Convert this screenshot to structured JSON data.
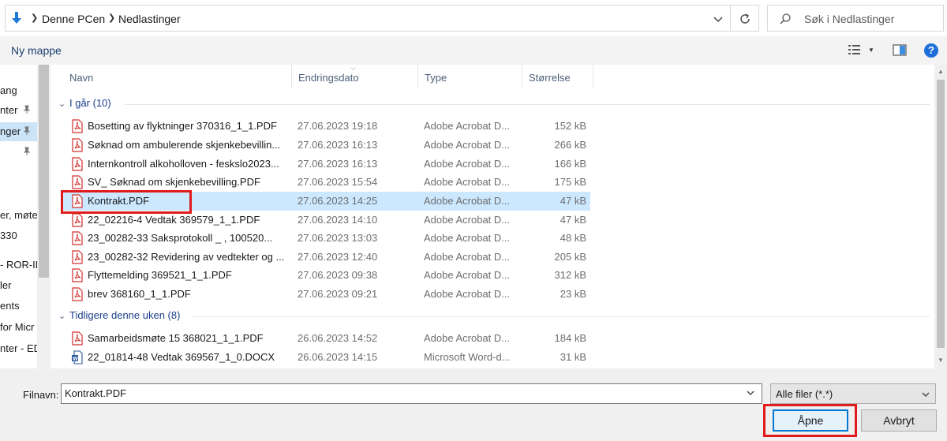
{
  "address": {
    "crumbs": [
      "Denne PCen",
      "Nedlastinger"
    ],
    "search_placeholder": "Søk i Nedlastinger"
  },
  "toolbar": {
    "new_folder_label": "Ny mappe",
    "help_label": "?"
  },
  "sidebar": {
    "items": [
      {
        "label": "ang",
        "pinned": false
      },
      {
        "label": "nter",
        "pinned": true
      },
      {
        "label": "nger",
        "pinned": true,
        "selected": true
      },
      {
        "label": "",
        "pinned": true
      },
      {
        "label": "er, møte",
        "pinned": false
      },
      {
        "label": "330",
        "pinned": false
      },
      {
        "label": "- ROR-IK",
        "pinned": false
      },
      {
        "label": "ler",
        "pinned": false
      },
      {
        "label": "ents",
        "pinned": false
      },
      {
        "label": "for Micr",
        "pinned": false
      },
      {
        "label": "nter - ED",
        "pinned": false
      }
    ]
  },
  "columns": [
    "Navn",
    "Endringsdato",
    "Type",
    "Størrelse"
  ],
  "groups": [
    {
      "label": "I går (10)",
      "rows": [
        {
          "name": "Bosetting av flyktninger 370316_1_1.PDF",
          "date": "27.06.2023 19:18",
          "type": "Adobe Acrobat D...",
          "size": "152 kB",
          "icon": "pdf"
        },
        {
          "name": "Søknad om ambulerende skjenkebevillin...",
          "date": "27.06.2023 16:13",
          "type": "Adobe Acrobat D...",
          "size": "266 kB",
          "icon": "pdf"
        },
        {
          "name": "Internkontroll alkoholloven - feskslo2023...",
          "date": "27.06.2023 16:13",
          "type": "Adobe Acrobat D...",
          "size": "166 kB",
          "icon": "pdf"
        },
        {
          "name": "SV_ Søknad om skjenkebevilling.PDF",
          "date": "27.06.2023 15:54",
          "type": "Adobe Acrobat D...",
          "size": "175 kB",
          "icon": "pdf"
        },
        {
          "name": "Kontrakt.PDF",
          "date": "27.06.2023 14:25",
          "type": "Adobe Acrobat D...",
          "size": "47 kB",
          "icon": "pdf",
          "selected": true
        },
        {
          "name": "22_02216-4 Vedtak 369579_1_1.PDF",
          "date": "27.06.2023 14:10",
          "type": "Adobe Acrobat D...",
          "size": "47 kB",
          "icon": "pdf"
        },
        {
          "name": "23_00282-33 Saksprotokoll _    , 100520...",
          "date": "27.06.2023 13:03",
          "type": "Adobe Acrobat D...",
          "size": "48 kB",
          "icon": "pdf"
        },
        {
          "name": "23_00282-32 Revidering av vedtekter og ...",
          "date": "27.06.2023 12:40",
          "type": "Adobe Acrobat D...",
          "size": "205 kB",
          "icon": "pdf"
        },
        {
          "name": "Flyttemelding 369521_1_1.PDF",
          "date": "27.06.2023 09:38",
          "type": "Adobe Acrobat D...",
          "size": "312 kB",
          "icon": "pdf"
        },
        {
          "name": "brev 368160_1_1.PDF",
          "date": "27.06.2023 09:21",
          "type": "Adobe Acrobat D...",
          "size": "23 kB",
          "icon": "pdf"
        }
      ]
    },
    {
      "label": "Tidligere denne uken (8)",
      "rows": [
        {
          "name": "Samarbeidsmøte 15 368021_1_1.PDF",
          "date": "26.06.2023 14:52",
          "type": "Adobe Acrobat D...",
          "size": "184 kB",
          "icon": "pdf"
        },
        {
          "name": "22_01814-48 Vedtak 369567_1_0.DOCX",
          "date": "26.06.2023 14:15",
          "type": "Microsoft Word-d...",
          "size": "31 kB",
          "icon": "word"
        }
      ]
    }
  ],
  "bottom": {
    "filename_label": "Filnavn:",
    "filename_value": "Kontrakt.PDF",
    "filter_value": "Alle filer (*.*)",
    "open_label": "Åpne",
    "cancel_label": "Avbryt"
  },
  "colors": {
    "accent": "#0078d7",
    "selection": "#cce8ff",
    "highlight_box": "#e01b1b",
    "pdf_red": "#d32f2f",
    "word_blue": "#2b579a"
  }
}
